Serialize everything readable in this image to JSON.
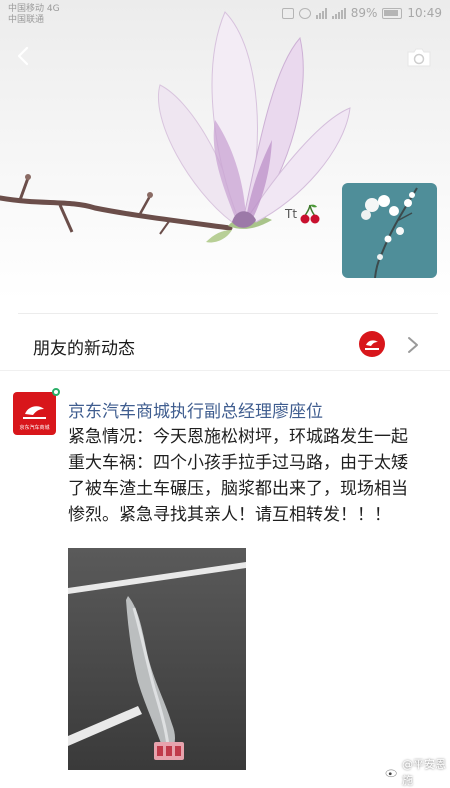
{
  "status_bar": {
    "carrier_line1": "中国移动",
    "carrier_line2": "中国联通",
    "network": "4G",
    "battery": "89%",
    "time": "10:49"
  },
  "header": {
    "back_icon": "chevron-left-icon",
    "camera_icon": "camera-icon",
    "signature_tag": "Tt"
  },
  "friends_updates": {
    "title": "朋友的新动态"
  },
  "post": {
    "author": "京东汽车商城执行副总经理廖座位",
    "avatar_text": "京东汽车商城",
    "body": "紧急情况：今天恩施松树坪，环城路发生一起重大车祸：四个小孩手拉手过马路，由于太矮了被车渣土车碾压，脑浆都出来了，现场相当惨烈。紧急寻找其亲人！请互相转发！！！"
  },
  "watermark": {
    "text": "@平安恩施"
  },
  "colors": {
    "author_link": "#3f5d8f",
    "brand_red": "#d8161b",
    "tile_teal": "#4f8e99"
  }
}
